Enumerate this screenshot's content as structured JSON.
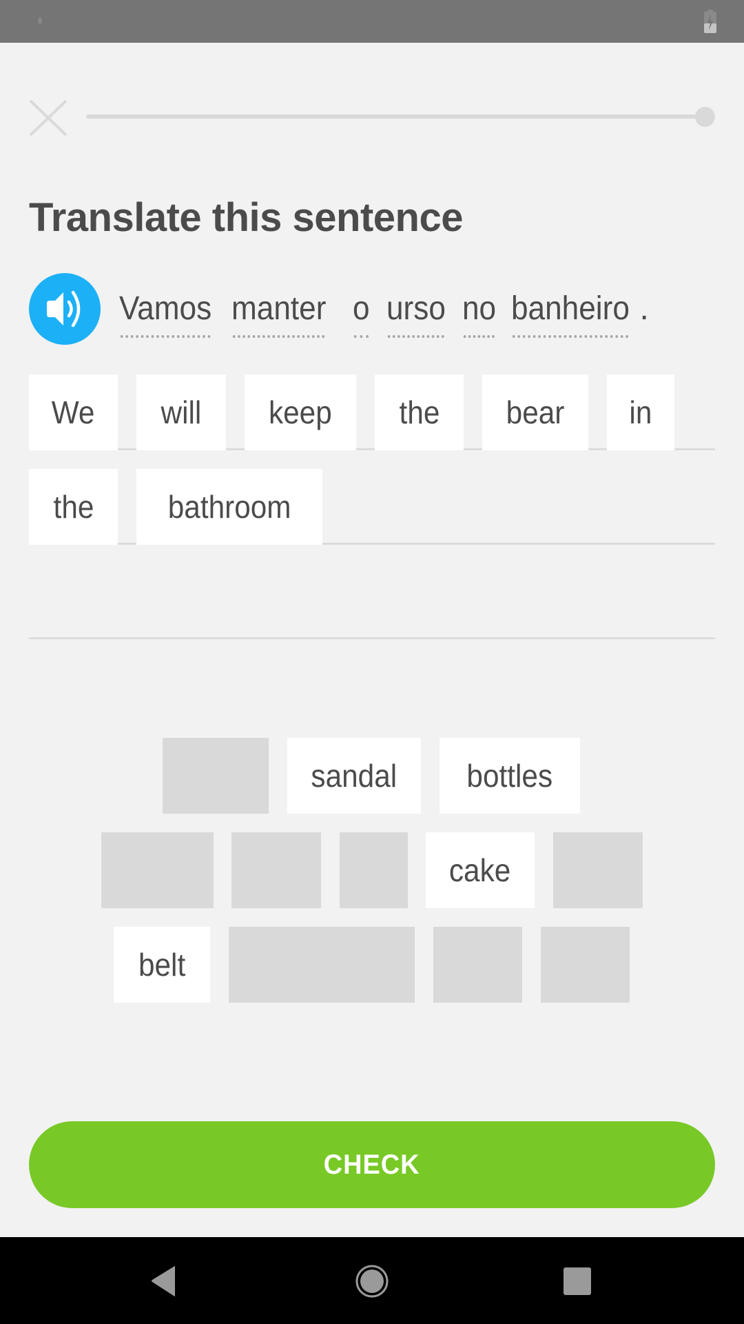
{
  "status_bar": {
    "notification_icon": "dot-icon",
    "battery_icon": "battery-charging-icon"
  },
  "header": {
    "close_icon": "close-icon",
    "progress_percent": 100
  },
  "exercise": {
    "title": "Translate this sentence",
    "speaker_icon": "speaker-icon",
    "prompt_words": [
      "Vamos",
      "manter",
      "o",
      "urso",
      "no",
      "banheiro"
    ],
    "prompt_punctuation": "."
  },
  "answer": {
    "row1": [
      "We",
      "will",
      "keep",
      "the",
      "bear",
      "in"
    ],
    "row2": [
      "the",
      "bathroom"
    ]
  },
  "word_bank": {
    "row1": [
      {
        "label": "",
        "used": true
      },
      {
        "label": "sandal",
        "used": false
      },
      {
        "label": "bottles",
        "used": false
      }
    ],
    "row2": [
      {
        "label": "",
        "used": true
      },
      {
        "label": "",
        "used": true
      },
      {
        "label": "",
        "used": true
      },
      {
        "label": "cake",
        "used": false
      },
      {
        "label": "",
        "used": true
      }
    ],
    "row3": [
      {
        "label": "belt",
        "used": false
      },
      {
        "label": "",
        "used": true
      },
      {
        "label": "",
        "used": true
      },
      {
        "label": "",
        "used": true
      }
    ]
  },
  "footer": {
    "check_label": "CHECK",
    "check_color": "#78c926"
  },
  "nav_bar": {
    "back_icon": "back-icon",
    "home_icon": "home-icon",
    "recents_icon": "recents-icon"
  },
  "colors": {
    "accent_blue": "#1cb0f6",
    "accent_green": "#78c926",
    "text": "#4b4b4b",
    "background": "#f2f2f2"
  }
}
